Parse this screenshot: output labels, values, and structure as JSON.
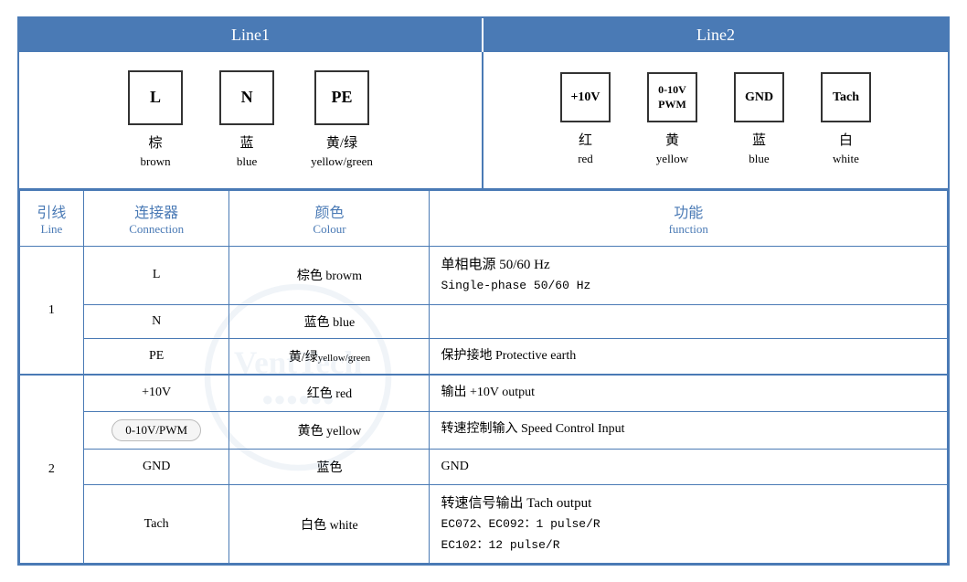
{
  "header": {
    "line1_label": "Line1",
    "line2_label": "Line2"
  },
  "diagram": {
    "line1": {
      "connectors": [
        {
          "symbol": "L",
          "zh": "棕",
          "en": "brown"
        },
        {
          "symbol": "N",
          "zh": "蓝",
          "en": "blue"
        },
        {
          "symbol": "PE",
          "zh": "黄/绿",
          "en": "yellow/green"
        }
      ]
    },
    "line2": {
      "connectors": [
        {
          "symbol": "+10V",
          "zh": "红",
          "en": "red"
        },
        {
          "symbol": "0-10V\nPWM",
          "zh": "黄",
          "en": "yellow"
        },
        {
          "symbol": "GND",
          "zh": "蓝",
          "en": "blue"
        },
        {
          "symbol": "Tach",
          "zh": "白",
          "en": "white"
        }
      ]
    }
  },
  "table": {
    "headers": {
      "line_zh": "引线",
      "line_en": "Line",
      "conn_zh": "连接器",
      "conn_en": "Connection",
      "colour_zh": "颜色",
      "colour_en": "Colour",
      "func_zh": "功能",
      "func_en": "function"
    },
    "rows": [
      {
        "line": "1",
        "rowspan": 3,
        "entries": [
          {
            "conn": "L",
            "colour_zh": "棕色",
            "colour_en": "browm",
            "func": "单相电源 50/60 Hz\nSingle-phase 50/60 Hz"
          },
          {
            "conn": "N",
            "colour_zh": "蓝色",
            "colour_en": "blue",
            "func": ""
          },
          {
            "conn": "PE",
            "colour_zh": "黄/绿",
            "colour_en": "yellow/green",
            "func": "保护接地 Protective earth"
          }
        ]
      },
      {
        "line": "2",
        "rowspan": 4,
        "entries": [
          {
            "conn": "+10V",
            "colour_zh": "红色",
            "colour_en": "red",
            "func": "输出 +10V output"
          },
          {
            "conn": "0-10V/PWM",
            "colour_zh": "黄色",
            "colour_en": "yellow",
            "func": "转速控制输入 Speed Control Input"
          },
          {
            "conn": "GND",
            "colour_zh": "蓝色",
            "colour_en": "",
            "func": "GND"
          },
          {
            "conn": "Tach",
            "colour_zh": "白色",
            "colour_en": "white",
            "func": "转速信号输出 Tach output\nEC072、EC092：1 pulse/R\nEC102：12 pulse/R"
          }
        ]
      }
    ]
  }
}
